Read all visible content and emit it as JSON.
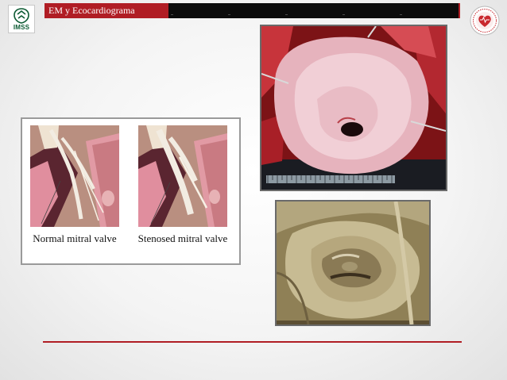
{
  "header": {
    "title": "EM y Ecocardiograma",
    "logo_text": "IMSS"
  },
  "diagram": {
    "left_caption": "Normal mitral valve",
    "right_caption": "Stenosed mitral valve"
  },
  "colors": {
    "accent_red": "#b01d24",
    "header_dark": "#0c0c0c"
  },
  "icons": {
    "left_logo": "imss-emblem-icon",
    "right_logo": "cardiology-society-heart-icon"
  }
}
